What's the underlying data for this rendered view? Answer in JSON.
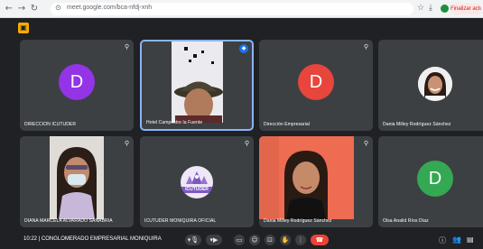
{
  "browser": {
    "url": "meet.google.com/bca-nfdj-xnh",
    "update_label": "Finalizar actualiz..."
  },
  "meeting": {
    "time": "10:22",
    "separator": "|",
    "name": "CONGLOMERADO EMPRESARIAL MONIQUIRA"
  },
  "participants": [
    {
      "name": "DIRECCION ICUTUDER",
      "type": "avatar",
      "letter": "D",
      "color": "#9334e6"
    },
    {
      "name": "Hotel Campestre la Fuente",
      "type": "video",
      "speaking": true
    },
    {
      "name": "Dirección Empresarial",
      "type": "avatar",
      "letter": "D",
      "color": "#e8453c"
    },
    {
      "name": "Dania Milley Rodríguez Sánchez",
      "type": "photo"
    },
    {
      "name": "DIANA MARCELA ALVARADO SANABRIA",
      "type": "video"
    },
    {
      "name": "ICUTUDER MONIQUIRA OFICIAL",
      "type": "logo",
      "logo_text": "ICUTUDER"
    },
    {
      "name": "Dania Milley Rodríguez Sánchez",
      "type": "video"
    },
    {
      "name": "Olsa Analid Ríos Díaz",
      "type": "avatar",
      "letter": "D",
      "color": "#34a853"
    }
  ],
  "icons": {
    "back": "arrow-left-icon",
    "forward": "arrow-right-icon",
    "reload": "reload-icon",
    "pin": "pin-icon",
    "mic": "mic-icon",
    "camera": "camera-icon",
    "captions": "captions-icon",
    "emoji": "emoji-icon",
    "present": "present-icon",
    "hand": "raise-hand-icon",
    "more": "more-icon",
    "leave": "end-call-icon",
    "info": "info-icon",
    "people": "people-icon",
    "chat": "chat-icon"
  }
}
